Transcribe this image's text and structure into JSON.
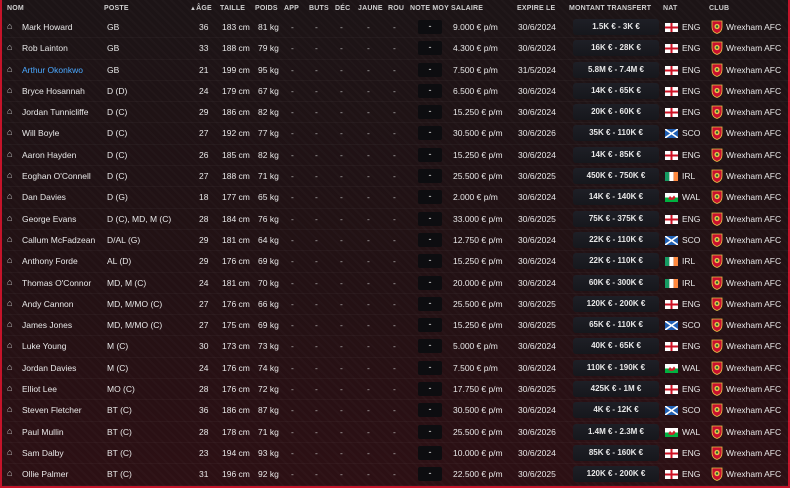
{
  "headers": {
    "name": "NOM",
    "poste": "POSTE",
    "age": "ÂGE",
    "taille": "TAILLE",
    "poids": "POIDS",
    "app": "APP",
    "buts": "BUTS",
    "dec": "DÉC",
    "jaune": "JAUNE",
    "rou": "ROU",
    "note": "NOTE MOY",
    "salaire": "SALAIRE",
    "expire": "EXPIRE LE",
    "montant": "MONTANT TRANSFERT",
    "nat": "NAT",
    "club": "CLUB"
  },
  "sort_icon": "sort-ascending-icon",
  "colors": {
    "accent": "#c5142a",
    "highlight": "#4aa8ff"
  },
  "players": [
    {
      "name": "Mark Howard",
      "pos": "GB",
      "age": "36",
      "height": "183 cm",
      "weight": "81 kg",
      "app": "-",
      "goals": "-",
      "assists": "-",
      "yellow": "-",
      "red": "-",
      "avg": "-",
      "wage": "9.000 € p/m",
      "expires": "30/6/2024",
      "value": "1.5K € - 3K €",
      "nat": "ENG",
      "flag": "eng",
      "club": "Wrexham AFC"
    },
    {
      "name": "Rob Lainton",
      "pos": "GB",
      "age": "33",
      "height": "188 cm",
      "weight": "79 kg",
      "app": "-",
      "goals": "-",
      "assists": "-",
      "yellow": "-",
      "red": "-",
      "avg": "-",
      "wage": "4.300 € p/m",
      "expires": "30/6/2024",
      "value": "16K € - 28K €",
      "nat": "ENG",
      "flag": "eng",
      "club": "Wrexham AFC"
    },
    {
      "name": "Arthur Okonkwo",
      "pos": "GB",
      "age": "21",
      "height": "199 cm",
      "weight": "95 kg",
      "app": "-",
      "goals": "-",
      "assists": "-",
      "yellow": "-",
      "red": "-",
      "avg": "-",
      "wage": "7.500 € p/m",
      "expires": "31/5/2024",
      "value": "5.8M € - 7.4M €",
      "nat": "ENG",
      "flag": "eng",
      "club": "Wrexham AFC",
      "highlight": true
    },
    {
      "name": "Bryce Hosannah",
      "pos": "D (D)",
      "age": "24",
      "height": "179 cm",
      "weight": "67 kg",
      "app": "-",
      "goals": "-",
      "assists": "-",
      "yellow": "-",
      "red": "-",
      "avg": "-",
      "wage": "6.500 € p/m",
      "expires": "30/6/2024",
      "value": "14K € - 65K €",
      "nat": "ENG",
      "flag": "eng",
      "club": "Wrexham AFC"
    },
    {
      "name": "Jordan Tunnicliffe",
      "pos": "D (C)",
      "age": "29",
      "height": "186 cm",
      "weight": "82 kg",
      "app": "-",
      "goals": "-",
      "assists": "-",
      "yellow": "-",
      "red": "-",
      "avg": "-",
      "wage": "15.250 € p/m",
      "expires": "30/6/2024",
      "value": "20K € - 60K €",
      "nat": "ENG",
      "flag": "eng",
      "club": "Wrexham AFC"
    },
    {
      "name": "Will Boyle",
      "pos": "D (C)",
      "age": "27",
      "height": "192 cm",
      "weight": "77 kg",
      "app": "-",
      "goals": "-",
      "assists": "-",
      "yellow": "-",
      "red": "-",
      "avg": "-",
      "wage": "30.500 € p/m",
      "expires": "30/6/2026",
      "value": "35K € - 110K €",
      "nat": "SCO",
      "flag": "sco",
      "club": "Wrexham AFC"
    },
    {
      "name": "Aaron Hayden",
      "pos": "D (C)",
      "age": "26",
      "height": "185 cm",
      "weight": "82 kg",
      "app": "-",
      "goals": "-",
      "assists": "-",
      "yellow": "-",
      "red": "-",
      "avg": "-",
      "wage": "15.250 € p/m",
      "expires": "30/6/2024",
      "value": "14K € - 85K €",
      "nat": "ENG",
      "flag": "eng",
      "club": "Wrexham AFC"
    },
    {
      "name": "Eoghan O'Connell",
      "pos": "D (C)",
      "age": "27",
      "height": "188 cm",
      "weight": "71 kg",
      "app": "-",
      "goals": "-",
      "assists": "-",
      "yellow": "-",
      "red": "-",
      "avg": "-",
      "wage": "25.500 € p/m",
      "expires": "30/6/2025",
      "value": "450K € - 750K €",
      "nat": "IRL",
      "flag": "irl",
      "club": "Wrexham AFC"
    },
    {
      "name": "Dan Davies",
      "pos": "D (G)",
      "age": "18",
      "height": "177 cm",
      "weight": "65 kg",
      "app": "-",
      "goals": "-",
      "assists": "-",
      "yellow": "-",
      "red": "-",
      "avg": "-",
      "wage": "2.000 € p/m",
      "expires": "30/6/2024",
      "value": "14K € - 140K €",
      "nat": "WAL",
      "flag": "wal",
      "club": "Wrexham AFC"
    },
    {
      "name": "George Evans",
      "pos": "D (C), MD, M (C)",
      "age": "28",
      "height": "184 cm",
      "weight": "76 kg",
      "app": "-",
      "goals": "-",
      "assists": "-",
      "yellow": "-",
      "red": "-",
      "avg": "-",
      "wage": "33.000 € p/m",
      "expires": "30/6/2025",
      "value": "75K € - 375K €",
      "nat": "ENG",
      "flag": "eng",
      "club": "Wrexham AFC"
    },
    {
      "name": "Callum McFadzean",
      "pos": "D/AL (G)",
      "age": "29",
      "height": "181 cm",
      "weight": "64 kg",
      "app": "-",
      "goals": "-",
      "assists": "-",
      "yellow": "-",
      "red": "-",
      "avg": "-",
      "wage": "12.750 € p/m",
      "expires": "30/6/2024",
      "value": "22K € - 110K €",
      "nat": "SCO",
      "flag": "sco",
      "club": "Wrexham AFC"
    },
    {
      "name": "Anthony Forde",
      "pos": "AL (D)",
      "age": "29",
      "height": "176 cm",
      "weight": "69 kg",
      "app": "-",
      "goals": "-",
      "assists": "-",
      "yellow": "-",
      "red": "-",
      "avg": "-",
      "wage": "15.250 € p/m",
      "expires": "30/6/2024",
      "value": "22K € - 110K €",
      "nat": "IRL",
      "flag": "irl",
      "club": "Wrexham AFC"
    },
    {
      "name": "Thomas O'Connor",
      "pos": "MD, M (C)",
      "age": "24",
      "height": "181 cm",
      "weight": "70 kg",
      "app": "-",
      "goals": "-",
      "assists": "-",
      "yellow": "-",
      "red": "-",
      "avg": "-",
      "wage": "20.000 € p/m",
      "expires": "30/6/2024",
      "value": "60K € - 300K €",
      "nat": "IRL",
      "flag": "irl",
      "club": "Wrexham AFC"
    },
    {
      "name": "Andy Cannon",
      "pos": "MD, M/MO (C)",
      "age": "27",
      "height": "176 cm",
      "weight": "66 kg",
      "app": "-",
      "goals": "-",
      "assists": "-",
      "yellow": "-",
      "red": "-",
      "avg": "-",
      "wage": "25.500 € p/m",
      "expires": "30/6/2025",
      "value": "120K € - 200K €",
      "nat": "ENG",
      "flag": "eng",
      "club": "Wrexham AFC"
    },
    {
      "name": "James Jones",
      "pos": "MD, M/MO (C)",
      "age": "27",
      "height": "175 cm",
      "weight": "69 kg",
      "app": "-",
      "goals": "-",
      "assists": "-",
      "yellow": "-",
      "red": "-",
      "avg": "-",
      "wage": "15.250 € p/m",
      "expires": "30/6/2025",
      "value": "65K € - 110K €",
      "nat": "SCO",
      "flag": "sco",
      "club": "Wrexham AFC"
    },
    {
      "name": "Luke Young",
      "pos": "M (C)",
      "age": "30",
      "height": "173 cm",
      "weight": "73 kg",
      "app": "-",
      "goals": "-",
      "assists": "-",
      "yellow": "-",
      "red": "-",
      "avg": "-",
      "wage": "5.000 € p/m",
      "expires": "30/6/2024",
      "value": "40K € - 65K €",
      "nat": "ENG",
      "flag": "eng",
      "club": "Wrexham AFC"
    },
    {
      "name": "Jordan Davies",
      "pos": "M (C)",
      "age": "24",
      "height": "176 cm",
      "weight": "74 kg",
      "app": "-",
      "goals": "-",
      "assists": "-",
      "yellow": "-",
      "red": "-",
      "avg": "-",
      "wage": "7.500 € p/m",
      "expires": "30/6/2024",
      "value": "110K € - 190K €",
      "nat": "WAL",
      "flag": "wal",
      "club": "Wrexham AFC"
    },
    {
      "name": "Elliot Lee",
      "pos": "MO (C)",
      "age": "28",
      "height": "176 cm",
      "weight": "72 kg",
      "app": "-",
      "goals": "-",
      "assists": "-",
      "yellow": "-",
      "red": "-",
      "avg": "-",
      "wage": "17.750 € p/m",
      "expires": "30/6/2025",
      "value": "425K € - 1M €",
      "nat": "ENG",
      "flag": "eng",
      "club": "Wrexham AFC"
    },
    {
      "name": "Steven Fletcher",
      "pos": "BT (C)",
      "age": "36",
      "height": "186 cm",
      "weight": "87 kg",
      "app": "-",
      "goals": "-",
      "assists": "-",
      "yellow": "-",
      "red": "-",
      "avg": "-",
      "wage": "30.500 € p/m",
      "expires": "30/6/2024",
      "value": "4K € - 12K €",
      "nat": "SCO",
      "flag": "sco",
      "club": "Wrexham AFC"
    },
    {
      "name": "Paul Mullin",
      "pos": "BT (C)",
      "age": "28",
      "height": "178 cm",
      "weight": "71 kg",
      "app": "-",
      "goals": "-",
      "assists": "-",
      "yellow": "-",
      "red": "-",
      "avg": "-",
      "wage": "25.500 € p/m",
      "expires": "30/6/2026",
      "value": "1.4M € - 2.3M €",
      "nat": "WAL",
      "flag": "wal",
      "club": "Wrexham AFC"
    },
    {
      "name": "Sam Dalby",
      "pos": "BT (C)",
      "age": "23",
      "height": "194 cm",
      "weight": "93 kg",
      "app": "-",
      "goals": "-",
      "assists": "-",
      "yellow": "-",
      "red": "-",
      "avg": "-",
      "wage": "10.000 € p/m",
      "expires": "30/6/2024",
      "value": "85K € - 160K €",
      "nat": "ENG",
      "flag": "eng",
      "club": "Wrexham AFC"
    },
    {
      "name": "Ollie Palmer",
      "pos": "BT (C)",
      "age": "31",
      "height": "196 cm",
      "weight": "92 kg",
      "app": "-",
      "goals": "-",
      "assists": "-",
      "yellow": "-",
      "red": "-",
      "avg": "-",
      "wage": "22.500 € p/m",
      "expires": "30/6/2025",
      "value": "120K € - 200K €",
      "nat": "ENG",
      "flag": "eng",
      "club": "Wrexham AFC"
    }
  ]
}
